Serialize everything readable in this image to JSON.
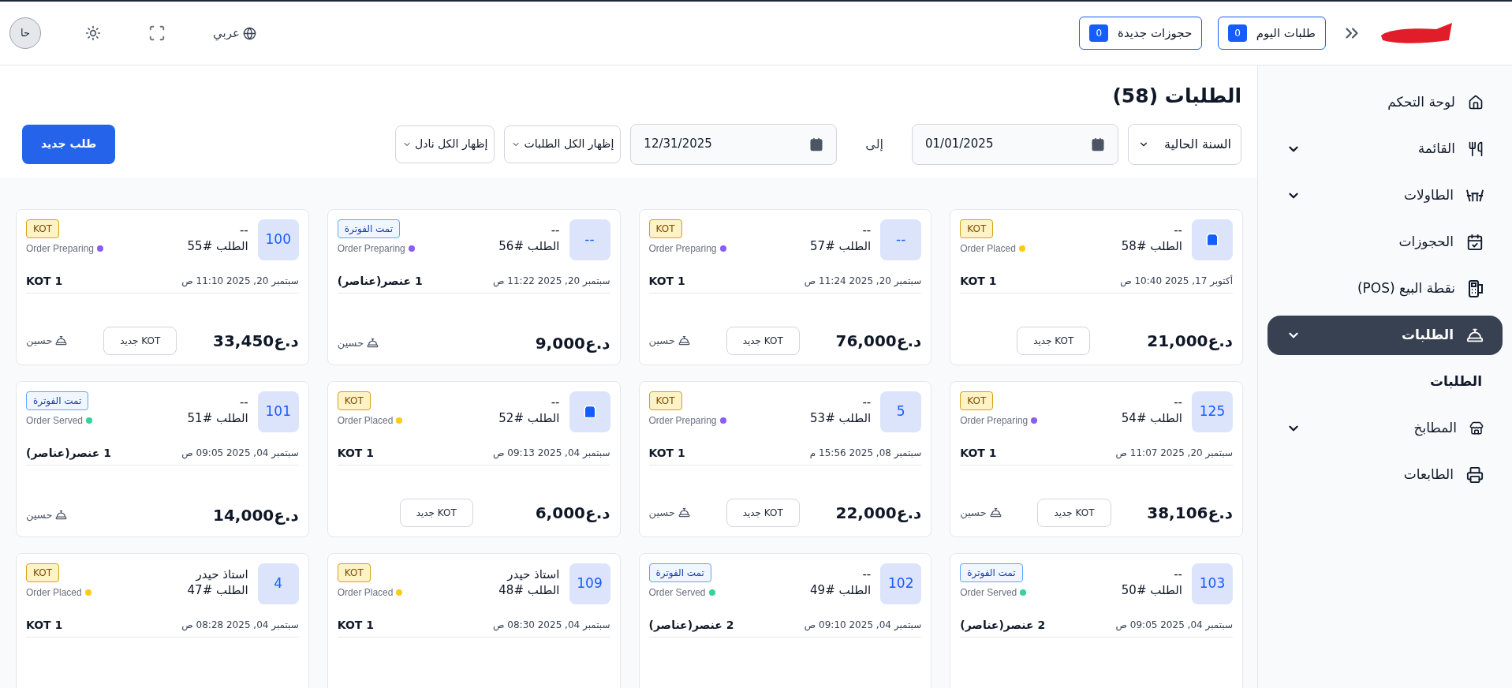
{
  "header": {
    "quick_buttons": [
      {
        "label": "طلبات اليوم",
        "count": "0"
      },
      {
        "label": "حجوزات جديدة",
        "count": "0"
      }
    ],
    "language": "عربي",
    "avatar": "حا"
  },
  "sidebar": {
    "items": [
      {
        "label": "لوحة التحكم",
        "kind": "link",
        "selected": false
      },
      {
        "label": "القائمة",
        "kind": "group",
        "selected": false
      },
      {
        "label": "الطاولات",
        "kind": "group",
        "selected": false
      },
      {
        "label": "الحجوزات",
        "kind": "link",
        "selected": false
      },
      {
        "label": "نقطة البيع (POS)",
        "kind": "link",
        "selected": false
      },
      {
        "label": "الطلبات",
        "kind": "group",
        "selected": true
      },
      {
        "label": "الطلبات",
        "kind": "subitem",
        "selected": false
      },
      {
        "label": "المطابخ",
        "kind": "group",
        "selected": false
      },
      {
        "label": "الطابعات",
        "kind": "link",
        "selected": false
      }
    ]
  },
  "page": {
    "title": "الطلبات (58)",
    "period": "السنة الحالية",
    "date_from": "01/01/2025",
    "to_label": "إلى",
    "date_to": "12/31/2025",
    "filters": [
      "إظهار الكل الطلبات",
      "إظهار الكل نادل"
    ],
    "new_order_button": "طلب جديد"
  },
  "orders": [
    {
      "badge": {
        "kind": "bag"
      },
      "customer": "--",
      "order": "الطلب #58",
      "tag": {
        "kind": "kot",
        "text": "KOT"
      },
      "status": "Order Placed",
      "color": "#facc15",
      "date": "أكتوبر 17, 2025 10:40 ص",
      "items": "KOT 1",
      "amount": "د.ع21,000",
      "button": "KOT جديد"
    },
    {
      "badge": {
        "kind": "number",
        "text": "--"
      },
      "customer": "--",
      "order": "الطلب #57",
      "tag": {
        "kind": "kot",
        "text": "KOT"
      },
      "status": "Order Preparing",
      "color": "#8b5cf6",
      "date": "سبتمبر 20, 2025 11:24 ص",
      "items": "KOT 1",
      "amount": "د.ع76,000",
      "button": "KOT جديد",
      "waiter": "حسين"
    },
    {
      "badge": {
        "kind": "number",
        "text": "--"
      },
      "customer": "--",
      "order": "الطلب #56",
      "tag": {
        "kind": "billed",
        "text": "تمت الفوترة"
      },
      "status": "Order Preparing",
      "color": "#8b5cf6",
      "date": "سبتمبر 20, 2025 11:22 ص",
      "items": "1 عنصر(عناصر)",
      "amount": "د.ع9,000",
      "waiter": "حسين"
    },
    {
      "badge": {
        "kind": "number",
        "text": "100"
      },
      "customer": "--",
      "order": "الطلب #55",
      "tag": {
        "kind": "kot",
        "text": "KOT"
      },
      "status": "Order Preparing",
      "color": "#8b5cf6",
      "date": "سبتمبر 20, 2025 11:10 ص",
      "items": "KOT 1",
      "amount": "د.ع33,450",
      "button": "KOT جديد",
      "waiter": "حسين"
    },
    {
      "badge": {
        "kind": "number",
        "text": "125"
      },
      "customer": "--",
      "order": "الطلب #54",
      "tag": {
        "kind": "kot",
        "text": "KOT"
      },
      "status": "Order Preparing",
      "color": "#8b5cf6",
      "date": "سبتمبر 20, 2025 11:07 ص",
      "items": "KOT 1",
      "amount": "د.ع38,106",
      "button": "KOT جديد",
      "waiter": "حسين"
    },
    {
      "badge": {
        "kind": "number",
        "text": "5"
      },
      "customer": "--",
      "order": "الطلب #53",
      "tag": {
        "kind": "kot",
        "text": "KOT"
      },
      "status": "Order Preparing",
      "color": "#8b5cf6",
      "date": "سبتمبر 08, 2025 15:56 م",
      "items": "KOT 1",
      "amount": "د.ع22,000",
      "button": "KOT جديد",
      "waiter": "حسين"
    },
    {
      "badge": {
        "kind": "bag"
      },
      "customer": "--",
      "order": "الطلب #52",
      "tag": {
        "kind": "kot",
        "text": "KOT"
      },
      "status": "Order Placed",
      "color": "#facc15",
      "date": "سبتمبر 04, 2025 09:13 ص",
      "items": "KOT 1",
      "amount": "د.ع6,000",
      "button": "KOT جديد"
    },
    {
      "badge": {
        "kind": "number",
        "text": "101"
      },
      "customer": "--",
      "order": "الطلب #51",
      "tag": {
        "kind": "billed",
        "text": "تمت الفوترة"
      },
      "status": "Order Served",
      "color": "#34d399",
      "date": "سبتمبر 04, 2025 09:05 ص",
      "items": "1 عنصر(عناصر)",
      "amount": "د.ع14,000",
      "waiter": "حسين"
    },
    {
      "badge": {
        "kind": "number",
        "text": "103"
      },
      "customer": "--",
      "order": "الطلب #50",
      "tag": {
        "kind": "billed",
        "text": "تمت الفوترة"
      },
      "status": "Order Served",
      "color": "#34d399",
      "date": "سبتمبر 04, 2025 09:05 ص",
      "items": "2 عنصر(عناصر)"
    },
    {
      "badge": {
        "kind": "number",
        "text": "102"
      },
      "customer": "--",
      "order": "الطلب #49",
      "tag": {
        "kind": "billed",
        "text": "تمت الفوترة"
      },
      "status": "Order Served",
      "color": "#34d399",
      "date": "سبتمبر 04, 2025 09:10 ص",
      "items": "2 عنصر(عناصر)"
    },
    {
      "badge": {
        "kind": "number",
        "text": "109"
      },
      "customer": "استاذ حيدر",
      "order": "الطلب #48",
      "tag": {
        "kind": "kot",
        "text": "KOT"
      },
      "status": "Order Placed",
      "color": "#facc15",
      "date": "سبتمبر 04, 2025 08:30 ص",
      "items": "KOT 1"
    },
    {
      "badge": {
        "kind": "number",
        "text": "4"
      },
      "customer": "استاذ حيدر",
      "order": "الطلب #47",
      "tag": {
        "kind": "kot",
        "text": "KOT"
      },
      "status": "Order Placed",
      "color": "#facc15",
      "date": "سبتمبر 04, 2025 08:28 ص",
      "items": "KOT 1"
    }
  ]
}
